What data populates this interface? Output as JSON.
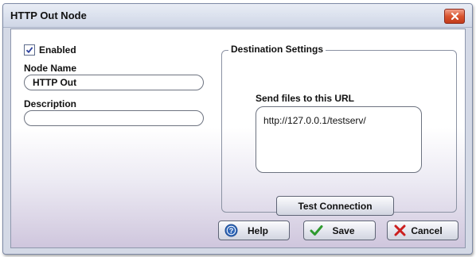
{
  "window": {
    "title": "HTTP Out Node"
  },
  "general": {
    "enabled_label": "Enabled",
    "enabled_checked": true,
    "node_name_label": "Node Name",
    "node_name_value": "HTTP Out",
    "description_label": "Description",
    "description_value": ""
  },
  "destination": {
    "group_title": "Destination Settings",
    "url_label": "Send files to this URL",
    "url_value": "http://127.0.0.1/testserv/",
    "test_button": "Test Connection"
  },
  "footer": {
    "help_label": "Help",
    "save_label": "Save",
    "cancel_label": "Cancel"
  },
  "colors": {
    "help_icon": "#2f66b8",
    "save_icon": "#2e9a2e",
    "cancel_icon": "#cc1f1f",
    "close_button": "#d9542f"
  },
  "icons": {
    "close": "close-icon",
    "checkbox": "checkmark-icon",
    "help": "help-icon",
    "save": "checkmark-icon",
    "cancel": "cancel-icon"
  }
}
